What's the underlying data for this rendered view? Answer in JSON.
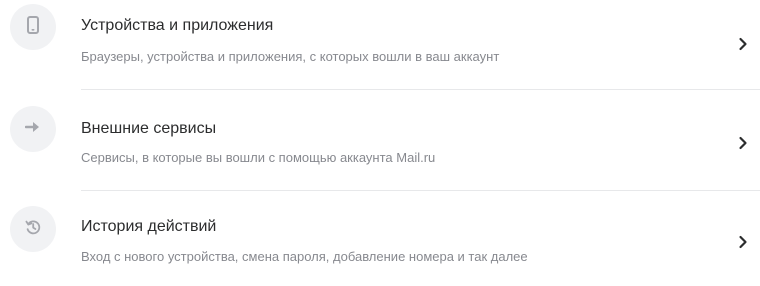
{
  "items": [
    {
      "icon": "mobile-device-icon",
      "title": "Устройства и приложения",
      "subtitle": "Браузеры, устройства и приложения, с которых вошли в ваш аккаунт"
    },
    {
      "icon": "arrow-right-icon",
      "title": "Внешние сервисы",
      "subtitle": "Сервисы, в которые вы вошли с помощью аккаунта Mail.ru"
    },
    {
      "icon": "history-icon",
      "title": "История действий",
      "subtitle": "Вход с нового устройства, смена пароля, добавление номера и так далее"
    }
  ],
  "colors": {
    "icon_background": "#f1f2f4",
    "icon_foreground": "#a5a7ad",
    "title": "#2c2d2e",
    "subtitle": "#87898f",
    "divider": "#e7e8ea",
    "chevron": "#2c2d2e"
  }
}
